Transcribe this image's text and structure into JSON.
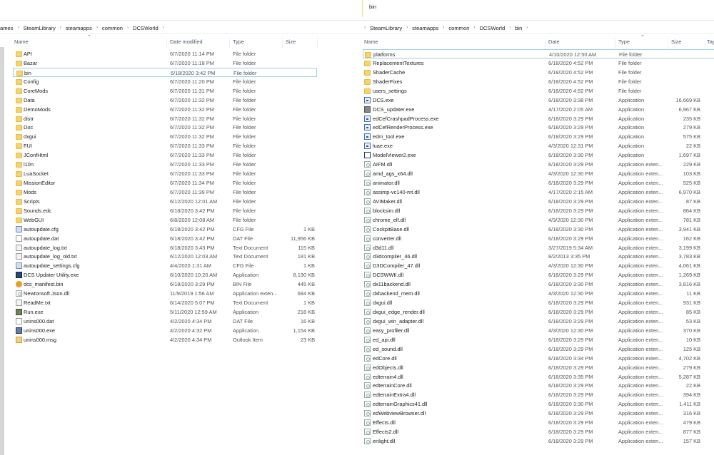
{
  "search": {
    "value": "bin"
  },
  "left": {
    "breadcrumb": [
      "ames",
      "SteamLibrary",
      "steamapps",
      "common",
      "DCSWorld"
    ],
    "columns": {
      "name": "Name",
      "date": "Date modified",
      "type": "Type",
      "size": "Size"
    },
    "selected_index": 2,
    "rows": [
      {
        "icon": "folder",
        "name": "API",
        "date": "6/7/2020 11:14 PM",
        "type": "File folder",
        "size": ""
      },
      {
        "icon": "folder",
        "name": "Bazar",
        "date": "6/7/2020 11:18 PM",
        "type": "File folder",
        "size": ""
      },
      {
        "icon": "folder",
        "name": "bin",
        "date": "6/18/2020 3:42 PM",
        "type": "File folder",
        "size": ""
      },
      {
        "icon": "folder",
        "name": "Config",
        "date": "6/7/2020 11:20 PM",
        "type": "File folder",
        "size": ""
      },
      {
        "icon": "folder",
        "name": "CoreMods",
        "date": "6/7/2020 11:31 PM",
        "type": "File folder",
        "size": ""
      },
      {
        "icon": "folder",
        "name": "Data",
        "date": "6/7/2020 11:32 PM",
        "type": "File folder",
        "size": ""
      },
      {
        "icon": "folder",
        "name": "DemoMods",
        "date": "6/7/2020 11:32 PM",
        "type": "File folder",
        "size": ""
      },
      {
        "icon": "folder",
        "name": "distr",
        "date": "6/7/2020 11:32 PM",
        "type": "File folder",
        "size": ""
      },
      {
        "icon": "folder",
        "name": "Doc",
        "date": "6/7/2020 11:32 PM",
        "type": "File folder",
        "size": ""
      },
      {
        "icon": "folder",
        "name": "dxgui",
        "date": "6/7/2020 11:32 PM",
        "type": "File folder",
        "size": ""
      },
      {
        "icon": "folder",
        "name": "FUI",
        "date": "6/7/2020 11:33 PM",
        "type": "File folder",
        "size": ""
      },
      {
        "icon": "folder",
        "name": "JConfHtml",
        "date": "6/7/2020 11:33 PM",
        "type": "File folder",
        "size": ""
      },
      {
        "icon": "folder",
        "name": "l10n",
        "date": "6/7/2020 11:33 PM",
        "type": "File folder",
        "size": ""
      },
      {
        "icon": "folder",
        "name": "LuaSocket",
        "date": "6/7/2020 11:33 PM",
        "type": "File folder",
        "size": ""
      },
      {
        "icon": "folder",
        "name": "MissionEditor",
        "date": "6/7/2020 11:34 PM",
        "type": "File folder",
        "size": ""
      },
      {
        "icon": "folder",
        "name": "Mods",
        "date": "6/7/2020 11:39 PM",
        "type": "File folder",
        "size": ""
      },
      {
        "icon": "folder",
        "name": "Scripts",
        "date": "6/12/2020 12:01 AM",
        "type": "File folder",
        "size": ""
      },
      {
        "icon": "folder",
        "name": "Sounds.edc",
        "date": "6/18/2020 3:42 PM",
        "type": "File folder",
        "size": ""
      },
      {
        "icon": "folder",
        "name": "WebGUI",
        "date": "6/8/2020 12:08 AM",
        "type": "File folder",
        "size": ""
      },
      {
        "icon": "cfg",
        "name": "autoupdate.cfg",
        "date": "6/18/2020 3:42 PM",
        "type": "CFG File",
        "size": "1 KB"
      },
      {
        "icon": "doc",
        "name": "autoupdate.dat",
        "date": "6/18/2020 3:42 PM",
        "type": "DAT File",
        "size": "11,956 KB"
      },
      {
        "icon": "txt",
        "name": "autoupdate_log.txt",
        "date": "6/18/2020 3:43 PM",
        "type": "Text Document",
        "size": "115 KB"
      },
      {
        "icon": "txt",
        "name": "autoupdate_log_old.txt",
        "date": "6/12/2020 12:03 AM",
        "type": "Text Document",
        "size": "181 KB"
      },
      {
        "icon": "cfg",
        "name": "autoupdate_settings.cfg",
        "date": "4/4/2020 1:31 AM",
        "type": "CFG File",
        "size": "1 KB"
      },
      {
        "icon": "app",
        "name": "DCS Updater Utility.exe",
        "date": "6/10/2020 10:20 AM",
        "type": "Application",
        "size": "8,190 KB"
      },
      {
        "icon": "bin",
        "name": "dcs_manifest.bin",
        "date": "6/18/2020 3:29 PM",
        "type": "BIN File",
        "size": "445 KB"
      },
      {
        "icon": "dll",
        "name": "Newtonsoft.Json.dll",
        "date": "11/9/2019 1:56 AM",
        "type": "Application exten...",
        "size": "684 KB"
      },
      {
        "icon": "txt",
        "name": "ReadMe.txt",
        "date": "6/14/2020 5:07 PM",
        "type": "Text Document",
        "size": "1 KB"
      },
      {
        "icon": "run",
        "name": "Run.exe",
        "date": "5/11/2020 12:59 AM",
        "type": "Application",
        "size": "218 KB"
      },
      {
        "icon": "doc",
        "name": "unins000.dat",
        "date": "4/2/2020 4:34 PM",
        "type": "DAT File",
        "size": "16 KB"
      },
      {
        "icon": "inst",
        "name": "unins000.exe",
        "date": "4/2/2020 4:32 PM",
        "type": "Application",
        "size": "1,154 KB"
      },
      {
        "icon": "msg",
        "name": "unins000.msg",
        "date": "4/2/2020 4:34 PM",
        "type": "Outlook Item",
        "size": "23 KB"
      }
    ]
  },
  "right": {
    "breadcrumb": [
      "SteamLibrary",
      "steamapps",
      "common",
      "DCSWorld",
      "bin"
    ],
    "columns": {
      "name": "Name",
      "date": "Date",
      "type": "Type",
      "size": "Size",
      "tags": "Tag"
    },
    "selected_index": 0,
    "rows": [
      {
        "icon": "folder",
        "name": "platforms",
        "date": "4/10/2020 12:50 AM",
        "type": "File folder",
        "size": ""
      },
      {
        "icon": "folder",
        "name": "ReplacementTextures",
        "date": "6/18/2020 4:52 PM",
        "type": "File folder",
        "size": ""
      },
      {
        "icon": "folder",
        "name": "ShaderCache",
        "date": "6/18/2020 4:52 PM",
        "type": "File folder",
        "size": ""
      },
      {
        "icon": "folder",
        "name": "ShaderFixes",
        "date": "6/18/2020 4:52 PM",
        "type": "File folder",
        "size": ""
      },
      {
        "icon": "folder",
        "name": "users_settings",
        "date": "6/18/2020 4:52 PM",
        "type": "File folder",
        "size": ""
      },
      {
        "icon": "exe",
        "name": "DCS.exe",
        "date": "6/18/2020 3:38 PM",
        "type": "Application",
        "size": "16,669 KB"
      },
      {
        "icon": "upd",
        "name": "DCS_updater.exe",
        "date": "4/17/2020 2:05 AM",
        "type": "Application",
        "size": "6,967 KB"
      },
      {
        "icon": "exe",
        "name": "edCefCrashpadProcess.exe",
        "date": "6/18/2020 3:29 PM",
        "type": "Application",
        "size": "235 KB"
      },
      {
        "icon": "exe",
        "name": "edCefRenderProcess.exe",
        "date": "6/18/2020 3:29 PM",
        "type": "Application",
        "size": "279 KB"
      },
      {
        "icon": "exe",
        "name": "edm_tool.exe",
        "date": "6/18/2020 3:29 PM",
        "type": "Application",
        "size": "575 KB"
      },
      {
        "icon": "exe",
        "name": "luae.exe",
        "date": "4/3/2020 12:31 PM",
        "type": "Application",
        "size": "22 KB"
      },
      {
        "icon": "mv",
        "name": "ModelViewer2.exe",
        "date": "6/18/2020 3:30 PM",
        "type": "Application",
        "size": "1,697 KB"
      },
      {
        "icon": "dll",
        "name": "AIFM.dll",
        "date": "6/18/2020 3:29 PM",
        "type": "Application exten...",
        "size": "229 KB"
      },
      {
        "icon": "dll",
        "name": "amd_ags_x64.dll",
        "date": "4/3/2020 12:30 PM",
        "type": "Application exten...",
        "size": "103 KB"
      },
      {
        "icon": "dll",
        "name": "animator.dll",
        "date": "6/18/2020 3:29 PM",
        "type": "Application exten...",
        "size": "525 KB"
      },
      {
        "icon": "dll",
        "name": "assimp-vc140-mt.dll",
        "date": "4/17/2020 2:15 AM",
        "type": "Application exten...",
        "size": "6,970 KB"
      },
      {
        "icon": "dll",
        "name": "AVIMaker.dll",
        "date": "6/18/2020 3:29 PM",
        "type": "Application exten...",
        "size": "87 KB"
      },
      {
        "icon": "dll",
        "name": "blocksim.dll",
        "date": "6/18/2020 3:29 PM",
        "type": "Application exten...",
        "size": "864 KB"
      },
      {
        "icon": "dll",
        "name": "chrome_elf.dll",
        "date": "4/3/2020 12:30 PM",
        "type": "Application exten...",
        "size": "781 KB"
      },
      {
        "icon": "dll",
        "name": "CockpitBase.dll",
        "date": "6/18/2020 3:30 PM",
        "type": "Application exten...",
        "size": "3,941 KB"
      },
      {
        "icon": "dll",
        "name": "converter.dll",
        "date": "6/18/2020 3:29 PM",
        "type": "Application exten...",
        "size": "162 KB"
      },
      {
        "icon": "dll",
        "name": "d3d11.dll",
        "date": "3/27/2019 5:34 AM",
        "type": "Application exten...",
        "size": "3,199 KB"
      },
      {
        "icon": "dll",
        "name": "d3dcompiler_46.dll",
        "date": "8/2/2013 3:35 PM",
        "type": "Application exten...",
        "size": "3,783 KB"
      },
      {
        "icon": "dll",
        "name": "D3DCompiler_47.dll",
        "date": "4/3/2020 12:30 PM",
        "type": "Application exten...",
        "size": "4,061 KB"
      },
      {
        "icon": "dll",
        "name": "DCSWWII.dll",
        "date": "6/18/2020 3:29 PM",
        "type": "Application exten...",
        "size": "1,269 KB"
      },
      {
        "icon": "dll",
        "name": "dx11backend.dll",
        "date": "6/18/2020 3:30 PM",
        "type": "Application exten...",
        "size": "3,816 KB"
      },
      {
        "icon": "dll",
        "name": "dxbackend_mem.dll",
        "date": "4/3/2020 12:30 PM",
        "type": "Application exten...",
        "size": "11 KB"
      },
      {
        "icon": "dll",
        "name": "dxgui.dll",
        "date": "6/18/2020 3:29 PM",
        "type": "Application exten...",
        "size": "931 KB"
      },
      {
        "icon": "dll",
        "name": "dxgui_edge_render.dll",
        "date": "6/18/2020 3:29 PM",
        "type": "Application exten...",
        "size": "85 KB"
      },
      {
        "icon": "dll",
        "name": "dxgui_win_adapter.dll",
        "date": "6/18/2020 3:29 PM",
        "type": "Application exten...",
        "size": "53 KB"
      },
      {
        "icon": "dll",
        "name": "easy_profiler.dll",
        "date": "4/3/2020 12:30 PM",
        "type": "Application exten...",
        "size": "370 KB"
      },
      {
        "icon": "dll",
        "name": "ed_api.dll",
        "date": "6/18/2020 3:29 PM",
        "type": "Application exten...",
        "size": "10 KB"
      },
      {
        "icon": "dll",
        "name": "ed_sound.dll",
        "date": "6/18/2020 3:29 PM",
        "type": "Application exten...",
        "size": "125 KB"
      },
      {
        "icon": "dll",
        "name": "edCore.dll",
        "date": "6/18/2020 3:34 PM",
        "type": "Application exten...",
        "size": "4,702 KB"
      },
      {
        "icon": "dll",
        "name": "edObjects.dll",
        "date": "6/18/2020 3:29 PM",
        "type": "Application exten...",
        "size": "279 KB"
      },
      {
        "icon": "dll",
        "name": "edterrain4.dll",
        "date": "6/18/2020 3:35 PM",
        "type": "Application exten...",
        "size": "5,287 KB"
      },
      {
        "icon": "dll",
        "name": "edterrainCore.dll",
        "date": "6/18/2020 3:29 PM",
        "type": "Application exten...",
        "size": "22 KB"
      },
      {
        "icon": "dll",
        "name": "edterrainExtra4.dll",
        "date": "6/18/2020 3:29 PM",
        "type": "Application exten...",
        "size": "394 KB"
      },
      {
        "icon": "dll",
        "name": "edterrainGraphics41.dll",
        "date": "6/18/2020 3:30 PM",
        "type": "Application exten...",
        "size": "1,411 KB"
      },
      {
        "icon": "dll",
        "name": "edWebviewBrowser.dll",
        "date": "6/18/2020 3:29 PM",
        "type": "Application exten...",
        "size": "316 KB"
      },
      {
        "icon": "dll",
        "name": "Effects.dll",
        "date": "6/18/2020 3:29 PM",
        "type": "Application exten...",
        "size": "479 KB"
      },
      {
        "icon": "dll",
        "name": "Effects2.dll",
        "date": "6/18/2020 3:29 PM",
        "type": "Application exten...",
        "size": "877 KB"
      },
      {
        "icon": "dll",
        "name": "enlight.dll",
        "date": "6/18/2020 3:29 PM",
        "type": "Application exten...",
        "size": "157 KB"
      }
    ]
  }
}
